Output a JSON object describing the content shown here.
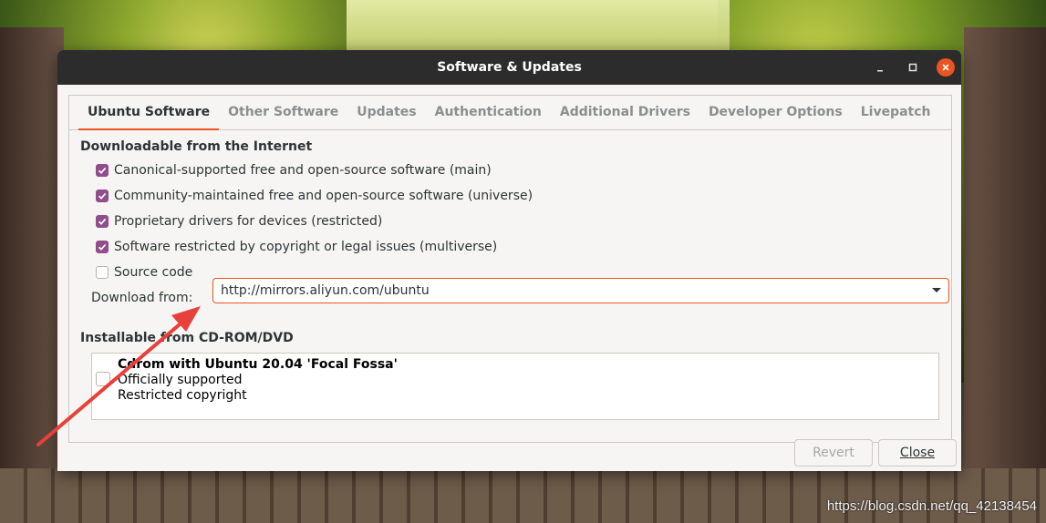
{
  "window": {
    "title": "Software & Updates"
  },
  "tabs": [
    {
      "label": "Ubuntu Software",
      "active": true
    },
    {
      "label": "Other Software",
      "active": false
    },
    {
      "label": "Updates",
      "active": false
    },
    {
      "label": "Authentication",
      "active": false
    },
    {
      "label": "Additional Drivers",
      "active": false
    },
    {
      "label": "Developer Options",
      "active": false
    },
    {
      "label": "Livepatch",
      "active": false
    }
  ],
  "downloadable": {
    "heading": "Downloadable from the Internet",
    "options": [
      {
        "label": "Canonical-supported free and open-source software (main)",
        "checked": true
      },
      {
        "label": "Community-maintained free and open-source software (universe)",
        "checked": true
      },
      {
        "label": "Proprietary drivers for devices (restricted)",
        "checked": true
      },
      {
        "label": "Software restricted by copyright or legal issues (multiverse)",
        "checked": true
      },
      {
        "label": "Source code",
        "checked": false
      }
    ],
    "download_from_label": "Download from:",
    "download_from_value": "http://mirrors.aliyun.com/ubuntu"
  },
  "cdrom": {
    "heading": "Installable from CD-ROM/DVD",
    "item_title": "Cdrom with Ubuntu 20.04 'Focal Fossa'",
    "item_line1": "Officially supported",
    "item_line2": "Restricted copyright",
    "checked": false
  },
  "buttons": {
    "revert": "Revert",
    "close": "Close"
  },
  "watermark": "https://blog.csdn.net/qq_42138454",
  "colors": {
    "accent": "#e95420",
    "checkbox": "#924d8b",
    "titlebar": "#2c2c2c",
    "annotation_arrow": "#e8403a"
  }
}
